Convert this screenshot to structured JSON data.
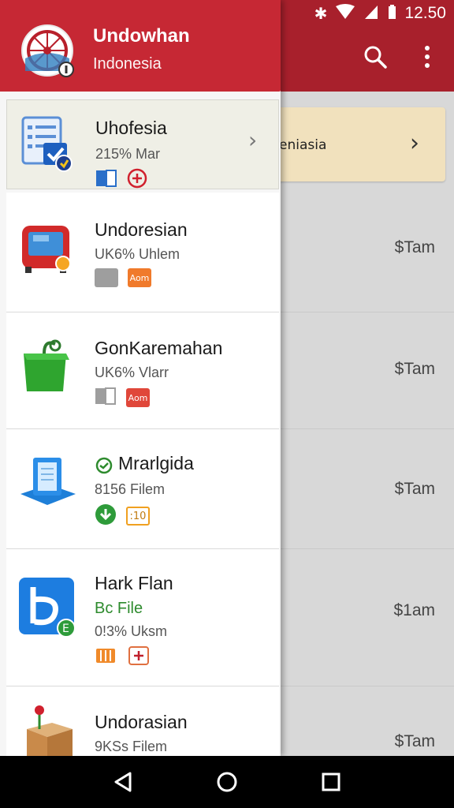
{
  "status_bar": {
    "time": "12.50"
  },
  "background": {
    "banner_text": "eniasia",
    "prices": [
      "$Tam",
      "$Tam",
      "$Tam",
      "$1am",
      "$Tam"
    ]
  },
  "drawer": {
    "header": {
      "title": "Undowhan",
      "subtitle": "Indonesia"
    },
    "items": [
      {
        "title": "Uhofesia",
        "subtitle": "215% Mar",
        "selected": true,
        "icon": "document-checklist-icon",
        "badges": [
          "blue-book",
          "plus-circle"
        ]
      },
      {
        "title": "Undoresian",
        "subtitle": "UK6% Uhlem",
        "icon": "red-tv-icon",
        "badges": [
          "gray",
          "orange"
        ],
        "badge_text": "Aom"
      },
      {
        "title": "GonKaremahan",
        "subtitle": "UK6% Vlarr",
        "icon": "green-bag-icon",
        "badges": [
          "gray-book",
          "red"
        ],
        "badge_text": "Aom"
      },
      {
        "title": "Mrarlgida",
        "subtitle": "8156 Filem",
        "icon": "blue-document-stand-icon",
        "badges": [
          "green-download",
          "orange-outline"
        ],
        "badge_text": ":10"
      },
      {
        "title": "Hark Flan",
        "extra": "Bc File",
        "subtitle": "0!3% Uksm",
        "icon": "blue-b-app-icon",
        "badges": [
          "orange-stack",
          "plus-square"
        ]
      },
      {
        "title": "Undorasian",
        "subtitle": "9KSs Filem",
        "icon": "box-pin-icon",
        "badges": []
      }
    ]
  }
}
